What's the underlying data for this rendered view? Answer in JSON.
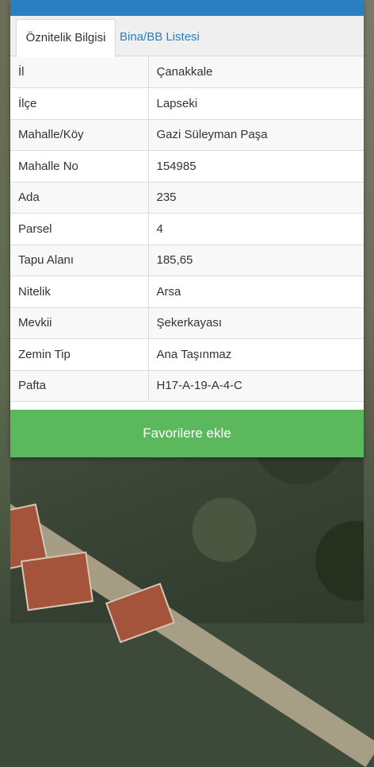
{
  "header": {
    "title": ""
  },
  "tabs": [
    {
      "label": "Öznitelik Bilgisi",
      "active": true
    },
    {
      "label": "Bina/BB Listesi",
      "active": false
    }
  ],
  "attributes": [
    {
      "key": "İl",
      "value": "Çanakkale"
    },
    {
      "key": "İlçe",
      "value": "Lapseki"
    },
    {
      "key": "Mahalle/Köy",
      "value": "Gazi Süleyman Paşa"
    },
    {
      "key": "Mahalle No",
      "value": "154985"
    },
    {
      "key": "Ada",
      "value": "235"
    },
    {
      "key": "Parsel",
      "value": "4"
    },
    {
      "key": "Tapu Alanı",
      "value": "185,65"
    },
    {
      "key": "Nitelik",
      "value": "Arsa"
    },
    {
      "key": "Mevkii",
      "value": "Şekerkayası"
    },
    {
      "key": "Zemin Tip",
      "value": "Ana Taşınmaz"
    },
    {
      "key": "Pafta",
      "value": "H17-A-19-A-4-C"
    }
  ],
  "actions": {
    "favorite_label": "Favorilere ekle"
  },
  "colors": {
    "header": "#2a7fc0",
    "tab_link": "#2a7fc0",
    "favorite_button": "#5cb85c"
  }
}
